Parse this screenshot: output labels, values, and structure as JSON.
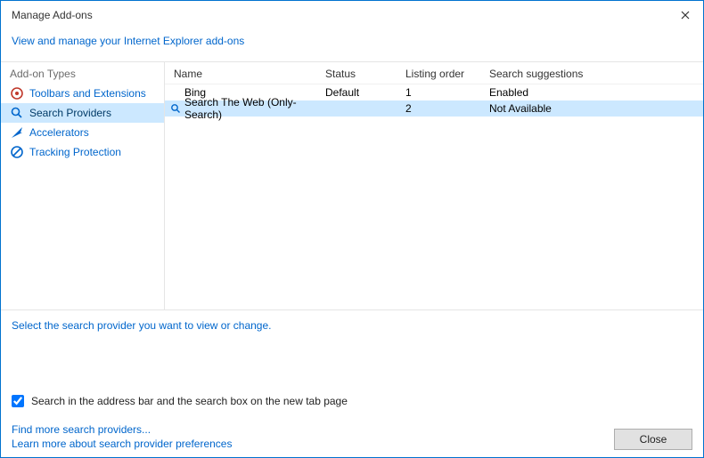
{
  "titlebar": {
    "title": "Manage Add-ons"
  },
  "subheader": {
    "link": "View and manage your Internet Explorer add-ons"
  },
  "sidebar": {
    "header": "Add-on Types",
    "items": [
      {
        "label": "Toolbars and Extensions"
      },
      {
        "label": "Search Providers"
      },
      {
        "label": "Accelerators"
      },
      {
        "label": "Tracking Protection"
      }
    ]
  },
  "columns": {
    "name": "Name",
    "status": "Status",
    "order": "Listing order",
    "suggestions": "Search suggestions"
  },
  "rows": [
    {
      "name": "Bing",
      "status": "Default",
      "order": "1",
      "suggestions": "Enabled"
    },
    {
      "name": "Search The Web (Only-Search)",
      "status": "",
      "order": "2",
      "suggestions": "Not Available"
    }
  ],
  "hint": "Select the search provider you want to view or change.",
  "checkbox": {
    "label": "Search in the address bar and the search box on the new tab page"
  },
  "links": {
    "find": "Find more search providers...",
    "learn": "Learn more about search provider preferences"
  },
  "buttons": {
    "close": "Close"
  }
}
